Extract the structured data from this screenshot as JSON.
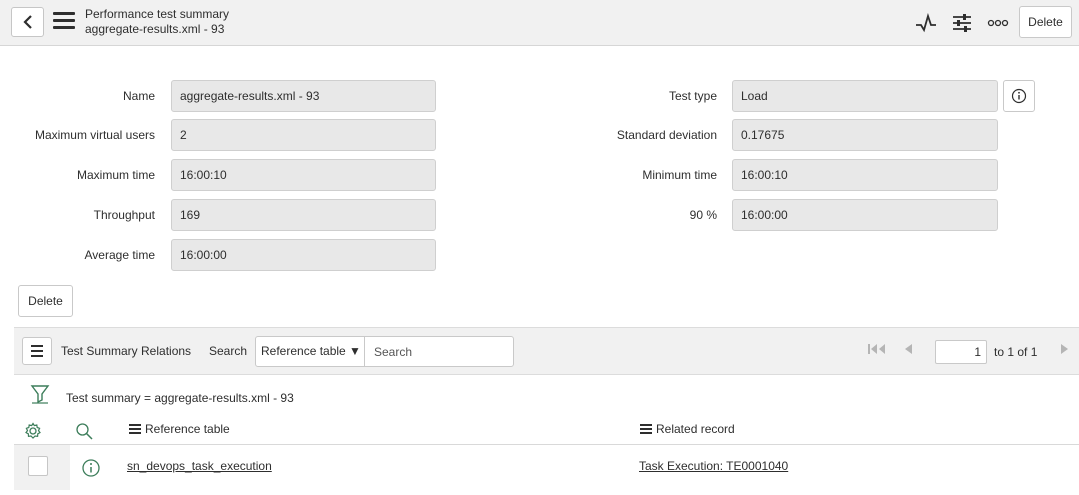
{
  "header": {
    "title": "Performance test summary",
    "subtitle": "aggregate-results.xml - 93",
    "delete_label": "Delete"
  },
  "form": {
    "left": [
      {
        "label": "Name",
        "value": "aggregate-results.xml - 93"
      },
      {
        "label": "Maximum virtual users",
        "value": "2"
      },
      {
        "label": "Maximum time",
        "value": "16:00:10"
      },
      {
        "label": "Throughput",
        "value": "169"
      },
      {
        "label": "Average time",
        "value": "16:00:00"
      }
    ],
    "right": [
      {
        "label": "Test type",
        "value": "Load"
      },
      {
        "label": "Standard deviation",
        "value": "0.17675"
      },
      {
        "label": "Minimum time",
        "value": "16:00:10"
      },
      {
        "label": "90 %",
        "value": "16:00:00"
      }
    ],
    "delete_label": "Delete"
  },
  "related_list": {
    "title": "Test Summary Relations",
    "search_label": "Search",
    "search_field": "Reference table ▼",
    "search_placeholder": "Search",
    "page_value": "1",
    "page_of": "to 1 of 1",
    "filter_text": "Test summary = aggregate-results.xml - 93",
    "columns": [
      "Reference table",
      "Related record"
    ],
    "rows": [
      {
        "reference_table": "sn_devops_task_execution",
        "related_record": "Task Execution: TE0001040"
      }
    ]
  },
  "colors": {
    "accent_green": "#3c7d5a",
    "header_bg": "#f1f1f1",
    "field_bg": "#e8e8e8"
  }
}
